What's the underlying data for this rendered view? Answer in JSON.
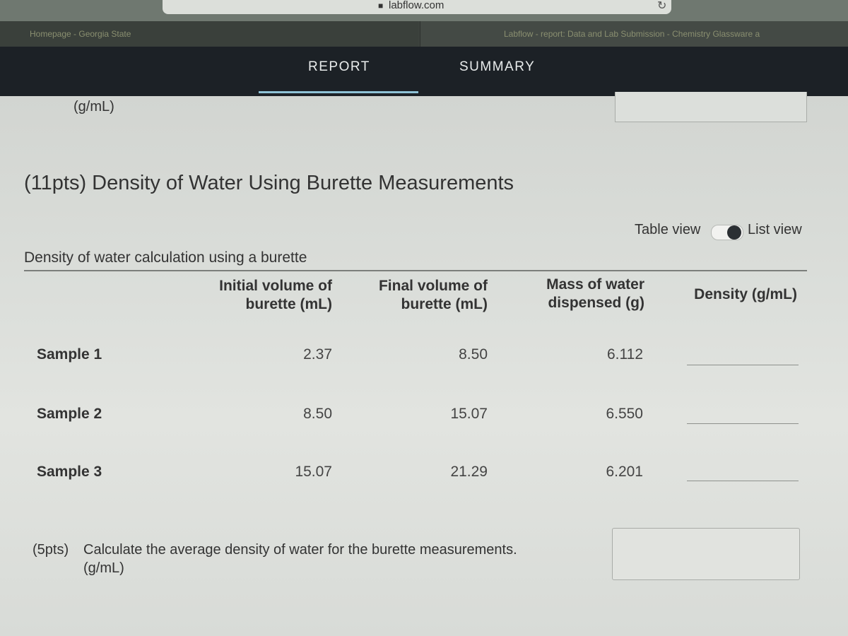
{
  "browser": {
    "url": "labflow.com",
    "tabs": [
      {
        "label": "Homepage - Georgia State"
      },
      {
        "label": "Labflow - report: Data and Lab Submission - Chemistry Glassware a"
      }
    ]
  },
  "nav": {
    "tabs": [
      {
        "label": "REPORT",
        "active": true
      },
      {
        "label": "SUMMARY",
        "active": false
      }
    ]
  },
  "previous_question": {
    "unit": "(g/mL)"
  },
  "section": {
    "title": "(11pts) Density of Water Using Burette Measurements"
  },
  "view_toggle": {
    "table_label": "Table view",
    "list_label": "List view",
    "selected": "List view"
  },
  "table": {
    "caption": "Density of water calculation using a burette",
    "columns": [
      {
        "line1": "Initial volume of",
        "line2": "burette (mL)"
      },
      {
        "line1": "Final volume of",
        "line2": "burette (mL)"
      },
      {
        "line1": "Mass of water",
        "line2": "dispensed (g)"
      },
      {
        "line1": "Density (g/mL)",
        "line2": ""
      }
    ],
    "rows": [
      {
        "label": "Sample 1",
        "initial": "2.37",
        "final": "8.50",
        "mass": "6.112",
        "density": ""
      },
      {
        "label": "Sample 2",
        "initial": "8.50",
        "final": "15.07",
        "mass": "6.550",
        "density": ""
      },
      {
        "label": "Sample 3",
        "initial": "15.07",
        "final": "21.29",
        "mass": "6.201",
        "density": ""
      }
    ]
  },
  "question": {
    "points": "(5pts)",
    "text": "Calculate the average density of water for the burette measurements.",
    "unit": "(g/mL)",
    "answer": ""
  },
  "colors": {
    "nav_background": "#1c2126",
    "active_tab_underline": "#8ec2d6",
    "page_background": "#dcdfdb"
  }
}
